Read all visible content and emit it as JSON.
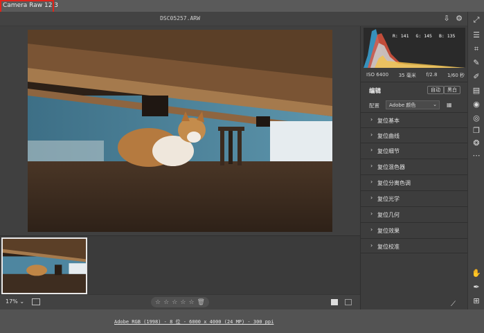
{
  "app": {
    "title": "Camera Raw 12.3"
  },
  "header": {
    "filename": "DSC05257.ARW"
  },
  "histogram": {
    "r": "R: 141",
    "g": "G: 145",
    "b": "B: 135"
  },
  "exif": {
    "iso": "ISO 6400",
    "focal": "35 毫米",
    "aperture": "f/2.8",
    "shutter": "1/60 秒"
  },
  "edit": {
    "title": "编辑",
    "auto_label": "自动",
    "bw_label": "黑白"
  },
  "profile": {
    "label": "配置",
    "value": "Adobe 颜色"
  },
  "sections": [
    "复位基本",
    "复位曲线",
    "复位细节",
    "复位混色器",
    "复位分离色调",
    "复位光学",
    "复位几何",
    "复位效果",
    "复位校准"
  ],
  "bottom": {
    "zoom": "17% ⌄",
    "rating_stars": [
      "☆",
      "☆",
      "☆",
      "☆",
      "☆"
    ]
  },
  "status": {
    "line": "Adobe RGB (1998) - 8 位 - 6000 x 4000 (24 MP) - 300 ppi"
  },
  "icons": {
    "save": "save-icon",
    "settings": "gear-icon",
    "fullscreen": "expand-icon",
    "edit": "sliders-icon",
    "crop": "crop-icon",
    "heal": "healing-icon",
    "brush": "brush-icon",
    "gradient": "gradient-icon",
    "radial": "radial-icon",
    "redeye": "redeye-icon",
    "snapshots": "snapshots-icon",
    "presets": "presets-icon",
    "more": "more-icon",
    "hand": "hand-icon",
    "sampler": "sampler-icon",
    "overlay": "overlay-icon",
    "eyedropper": "eyedropper-icon"
  }
}
